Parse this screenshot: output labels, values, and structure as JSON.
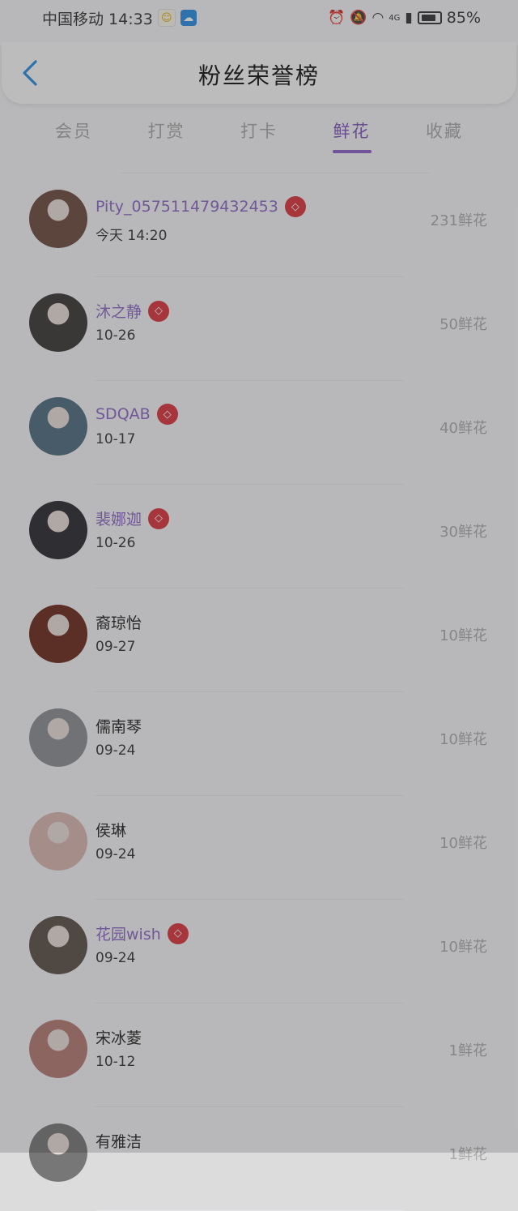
{
  "status_bar": {
    "carrier_time": "中国移动 14:33",
    "network": "4G",
    "battery": "85%"
  },
  "header": {
    "title": "粉丝荣誉榜",
    "back_icon": "chevron-left-icon"
  },
  "tabs": [
    {
      "label": "会员",
      "active": false
    },
    {
      "label": "打赏",
      "active": false
    },
    {
      "label": "打卡",
      "active": false
    },
    {
      "label": "鲜花",
      "active": true
    },
    {
      "label": "收藏",
      "active": false
    }
  ],
  "colors": {
    "accent": "#8a5fc8",
    "back": "#2a8de0",
    "vip_badge": "#d9343c"
  },
  "fans": [
    {
      "name": "Pity_057511479432453",
      "vip": true,
      "date": "今天 14:20",
      "count": "231鲜花",
      "avatar_color": "#6b4a3e"
    },
    {
      "name": "沐之静",
      "vip": true,
      "date": "10-26",
      "count": "50鲜花",
      "avatar_color": "#3a3535"
    },
    {
      "name": "SDQAB",
      "vip": true,
      "date": "10-17",
      "count": "40鲜花",
      "avatar_color": "#4d6a7e"
    },
    {
      "name": "裴娜迦",
      "vip": true,
      "date": "10-26",
      "count": "30鲜花",
      "avatar_color": "#2a2a30"
    },
    {
      "name": "裔琼怡",
      "vip": false,
      "date": "09-27",
      "count": "10鲜花",
      "avatar_color": "#6a2a1c"
    },
    {
      "name": "儒南琴",
      "vip": false,
      "date": "09-24",
      "count": "10鲜花",
      "avatar_color": "#8a8c92"
    },
    {
      "name": "侯琳",
      "vip": false,
      "date": "09-24",
      "count": "10鲜花",
      "avatar_color": "#d8b5b0"
    },
    {
      "name": "花园wish",
      "vip": true,
      "date": "09-24",
      "count": "10鲜花",
      "avatar_color": "#5a5048"
    },
    {
      "name": "宋冰菱",
      "vip": false,
      "date": "10-12",
      "count": "1鲜花",
      "avatar_color": "#b37a74"
    },
    {
      "name": "有雅洁",
      "vip": false,
      "date": "",
      "count": "1鲜花",
      "avatar_color": "#777777"
    }
  ]
}
